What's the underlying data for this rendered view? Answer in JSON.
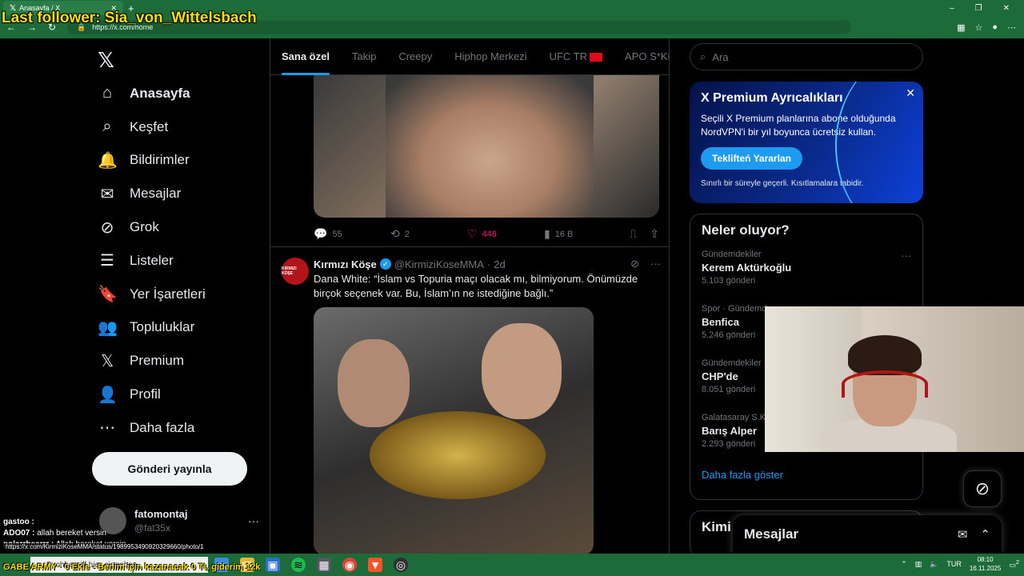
{
  "overlay": {
    "stream_title": "Last follower: Sia_von_Wittelsbach",
    "ticker": "GABE ARMY · 0 Ekle - Benim için kazanacak 0 TL giderim 12k"
  },
  "browser": {
    "tab_title": "Anasayfa / X",
    "url": "https://x.com/home",
    "new_tab": "+",
    "win_min": "–",
    "win_max": "❐",
    "win_close": "✕"
  },
  "nav": {
    "logo": "𝕏",
    "items": [
      {
        "label": "Anasayfa",
        "icon": "home-icon",
        "glyph": "⌂"
      },
      {
        "label": "Keşfet",
        "icon": "search-icon",
        "glyph": "⌕"
      },
      {
        "label": "Bildirimler",
        "icon": "bell-icon",
        "glyph": "🔔"
      },
      {
        "label": "Mesajlar",
        "icon": "mail-icon",
        "glyph": "✉"
      },
      {
        "label": "Grok",
        "icon": "grok-icon",
        "glyph": "⊘"
      },
      {
        "label": "Listeler",
        "icon": "list-icon",
        "glyph": "☰"
      },
      {
        "label": "Yer İşaretleri",
        "icon": "bookmark-icon",
        "glyph": "🔖"
      },
      {
        "label": "Topluluklar",
        "icon": "communities-icon",
        "glyph": "👥"
      },
      {
        "label": "Premium",
        "icon": "x-premium-icon",
        "glyph": "𝕏"
      },
      {
        "label": "Profil",
        "icon": "profile-icon",
        "glyph": "👤"
      },
      {
        "label": "Daha fazla",
        "icon": "more-icon",
        "glyph": "⋯"
      }
    ],
    "post_button": "Gönderi yayınla",
    "profile_name": "fatomontaj",
    "profile_handle": "@fat35x",
    "profile_more": "···"
  },
  "feed": {
    "tabs": [
      "Sana özel",
      "Takip",
      "Creepy",
      "Hiphop Merkezi",
      "UFC TR",
      "APO S*KEN"
    ],
    "tweet1_actions": {
      "replies": "55",
      "retweets": "2",
      "likes": "448",
      "views": "16 B"
    },
    "tweet2": {
      "avatar_text": "KIRMIZI KÖŞE",
      "name": "Kırmızı Köşe",
      "handle": "@KirmiziKoseMMA",
      "dot": "·",
      "time": "2d",
      "text": "Dana White: “İslam vs Topuria maçı olacak mı, bilmiyorum. Önümüzde birçok seçenek var. Bu, İslam’ın ne istediğine bağlı.”",
      "more": "···"
    }
  },
  "sidebar": {
    "search_placeholder": "Ara",
    "premium": {
      "title": "X Premium Ayrıcalıkları",
      "body": "Seçili X Premium planlarına abone olduğunda NordVPN'i bir yıl boyunca ücretsiz kullan.",
      "button": "Teklifteń Yararlan",
      "note": "Sınırlı bir süreyle geçerli. Kısıtlamalara tabidir.",
      "close": "✕"
    },
    "trends_title": "Neler oluyor?",
    "trends": [
      {
        "category": "Gündemdekiler",
        "name": "Kerem Aktürkoğlu",
        "count": "5.103 gönderi"
      },
      {
        "category": "Spor · Gündemde",
        "name": "Benfica",
        "count": "5.246 gönderi"
      },
      {
        "category": "Gündemdekiler",
        "name": "CHP'de",
        "count": "8.051 gönderi"
      },
      {
        "category": "Galatasaray S.K.",
        "name": "Barış Alper",
        "count": "2.293 gönderi"
      }
    ],
    "show_more": "Daha fazla göster",
    "who_to_follow": "Kimi",
    "messages_drawer": "Mesajlar"
  },
  "chat": [
    {
      "user": "gastoo :",
      "msg": ""
    },
    {
      "user": "ADO07 :",
      "msg": "allah bereket versin"
    },
    {
      "user": "polarrbearrr :",
      "msg": "Allah bereket versin"
    }
  ],
  "status_link": "https://x.com/KirmiziKoseMMA/status/1989953490920329660/photo/1",
  "taskbar": {
    "search": "Suchbegriff hier eingeben",
    "lang": "TUR",
    "time": "08:10",
    "date": "16.11.2025",
    "notif": "2"
  }
}
